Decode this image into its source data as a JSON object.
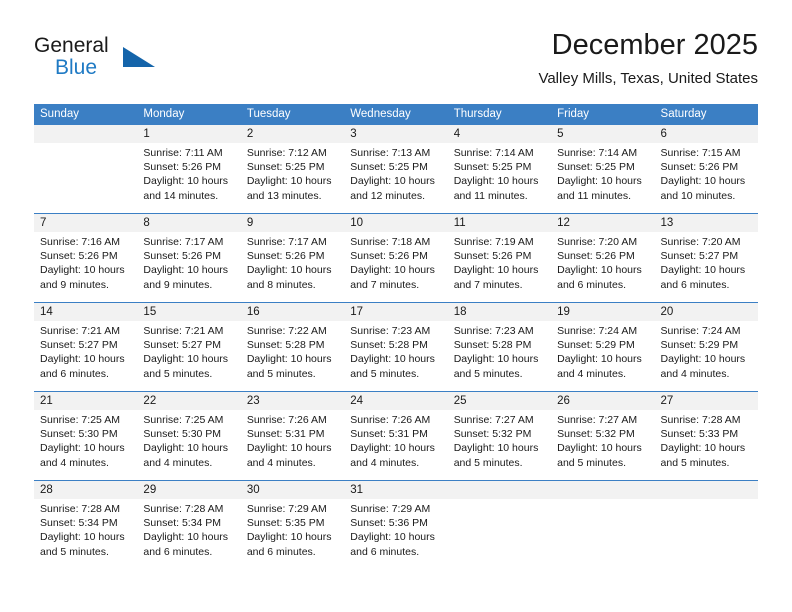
{
  "brand": {
    "name_part1": "General",
    "name_part2": "Blue",
    "logo_icon": "triangle-icon",
    "accent_color": "#1464aa",
    "blue_text_color": "#1f7ac4"
  },
  "header": {
    "title": "December 2025",
    "subtitle": "Valley Mills, Texas, United States"
  },
  "calendar": {
    "header_bg_color": "#3b7fc4",
    "daynum_bg_color": "#f2f2f2",
    "weekdays": [
      "Sunday",
      "Monday",
      "Tuesday",
      "Wednesday",
      "Thursday",
      "Friday",
      "Saturday"
    ],
    "weeks": [
      {
        "days": [
          {
            "num": "",
            "sunrise": "",
            "sunset": "",
            "daylight": ""
          },
          {
            "num": "1",
            "sunrise": "Sunrise: 7:11 AM",
            "sunset": "Sunset: 5:26 PM",
            "daylight": "Daylight: 10 hours and 14 minutes."
          },
          {
            "num": "2",
            "sunrise": "Sunrise: 7:12 AM",
            "sunset": "Sunset: 5:25 PM",
            "daylight": "Daylight: 10 hours and 13 minutes."
          },
          {
            "num": "3",
            "sunrise": "Sunrise: 7:13 AM",
            "sunset": "Sunset: 5:25 PM",
            "daylight": "Daylight: 10 hours and 12 minutes."
          },
          {
            "num": "4",
            "sunrise": "Sunrise: 7:14 AM",
            "sunset": "Sunset: 5:25 PM",
            "daylight": "Daylight: 10 hours and 11 minutes."
          },
          {
            "num": "5",
            "sunrise": "Sunrise: 7:14 AM",
            "sunset": "Sunset: 5:25 PM",
            "daylight": "Daylight: 10 hours and 11 minutes."
          },
          {
            "num": "6",
            "sunrise": "Sunrise: 7:15 AM",
            "sunset": "Sunset: 5:26 PM",
            "daylight": "Daylight: 10 hours and 10 minutes."
          }
        ]
      },
      {
        "days": [
          {
            "num": "7",
            "sunrise": "Sunrise: 7:16 AM",
            "sunset": "Sunset: 5:26 PM",
            "daylight": "Daylight: 10 hours and 9 minutes."
          },
          {
            "num": "8",
            "sunrise": "Sunrise: 7:17 AM",
            "sunset": "Sunset: 5:26 PM",
            "daylight": "Daylight: 10 hours and 9 minutes."
          },
          {
            "num": "9",
            "sunrise": "Sunrise: 7:17 AM",
            "sunset": "Sunset: 5:26 PM",
            "daylight": "Daylight: 10 hours and 8 minutes."
          },
          {
            "num": "10",
            "sunrise": "Sunrise: 7:18 AM",
            "sunset": "Sunset: 5:26 PM",
            "daylight": "Daylight: 10 hours and 7 minutes."
          },
          {
            "num": "11",
            "sunrise": "Sunrise: 7:19 AM",
            "sunset": "Sunset: 5:26 PM",
            "daylight": "Daylight: 10 hours and 7 minutes."
          },
          {
            "num": "12",
            "sunrise": "Sunrise: 7:20 AM",
            "sunset": "Sunset: 5:26 PM",
            "daylight": "Daylight: 10 hours and 6 minutes."
          },
          {
            "num": "13",
            "sunrise": "Sunrise: 7:20 AM",
            "sunset": "Sunset: 5:27 PM",
            "daylight": "Daylight: 10 hours and 6 minutes."
          }
        ]
      },
      {
        "days": [
          {
            "num": "14",
            "sunrise": "Sunrise: 7:21 AM",
            "sunset": "Sunset: 5:27 PM",
            "daylight": "Daylight: 10 hours and 6 minutes."
          },
          {
            "num": "15",
            "sunrise": "Sunrise: 7:21 AM",
            "sunset": "Sunset: 5:27 PM",
            "daylight": "Daylight: 10 hours and 5 minutes."
          },
          {
            "num": "16",
            "sunrise": "Sunrise: 7:22 AM",
            "sunset": "Sunset: 5:28 PM",
            "daylight": "Daylight: 10 hours and 5 minutes."
          },
          {
            "num": "17",
            "sunrise": "Sunrise: 7:23 AM",
            "sunset": "Sunset: 5:28 PM",
            "daylight": "Daylight: 10 hours and 5 minutes."
          },
          {
            "num": "18",
            "sunrise": "Sunrise: 7:23 AM",
            "sunset": "Sunset: 5:28 PM",
            "daylight": "Daylight: 10 hours and 5 minutes."
          },
          {
            "num": "19",
            "sunrise": "Sunrise: 7:24 AM",
            "sunset": "Sunset: 5:29 PM",
            "daylight": "Daylight: 10 hours and 4 minutes."
          },
          {
            "num": "20",
            "sunrise": "Sunrise: 7:24 AM",
            "sunset": "Sunset: 5:29 PM",
            "daylight": "Daylight: 10 hours and 4 minutes."
          }
        ]
      },
      {
        "days": [
          {
            "num": "21",
            "sunrise": "Sunrise: 7:25 AM",
            "sunset": "Sunset: 5:30 PM",
            "daylight": "Daylight: 10 hours and 4 minutes."
          },
          {
            "num": "22",
            "sunrise": "Sunrise: 7:25 AM",
            "sunset": "Sunset: 5:30 PM",
            "daylight": "Daylight: 10 hours and 4 minutes."
          },
          {
            "num": "23",
            "sunrise": "Sunrise: 7:26 AM",
            "sunset": "Sunset: 5:31 PM",
            "daylight": "Daylight: 10 hours and 4 minutes."
          },
          {
            "num": "24",
            "sunrise": "Sunrise: 7:26 AM",
            "sunset": "Sunset: 5:31 PM",
            "daylight": "Daylight: 10 hours and 4 minutes."
          },
          {
            "num": "25",
            "sunrise": "Sunrise: 7:27 AM",
            "sunset": "Sunset: 5:32 PM",
            "daylight": "Daylight: 10 hours and 5 minutes."
          },
          {
            "num": "26",
            "sunrise": "Sunrise: 7:27 AM",
            "sunset": "Sunset: 5:32 PM",
            "daylight": "Daylight: 10 hours and 5 minutes."
          },
          {
            "num": "27",
            "sunrise": "Sunrise: 7:28 AM",
            "sunset": "Sunset: 5:33 PM",
            "daylight": "Daylight: 10 hours and 5 minutes."
          }
        ]
      },
      {
        "days": [
          {
            "num": "28",
            "sunrise": "Sunrise: 7:28 AM",
            "sunset": "Sunset: 5:34 PM",
            "daylight": "Daylight: 10 hours and 5 minutes."
          },
          {
            "num": "29",
            "sunrise": "Sunrise: 7:28 AM",
            "sunset": "Sunset: 5:34 PM",
            "daylight": "Daylight: 10 hours and 6 minutes."
          },
          {
            "num": "30",
            "sunrise": "Sunrise: 7:29 AM",
            "sunset": "Sunset: 5:35 PM",
            "daylight": "Daylight: 10 hours and 6 minutes."
          },
          {
            "num": "31",
            "sunrise": "Sunrise: 7:29 AM",
            "sunset": "Sunset: 5:36 PM",
            "daylight": "Daylight: 10 hours and 6 minutes."
          },
          {
            "num": "",
            "sunrise": "",
            "sunset": "",
            "daylight": ""
          },
          {
            "num": "",
            "sunrise": "",
            "sunset": "",
            "daylight": ""
          },
          {
            "num": "",
            "sunrise": "",
            "sunset": "",
            "daylight": ""
          }
        ]
      }
    ]
  }
}
